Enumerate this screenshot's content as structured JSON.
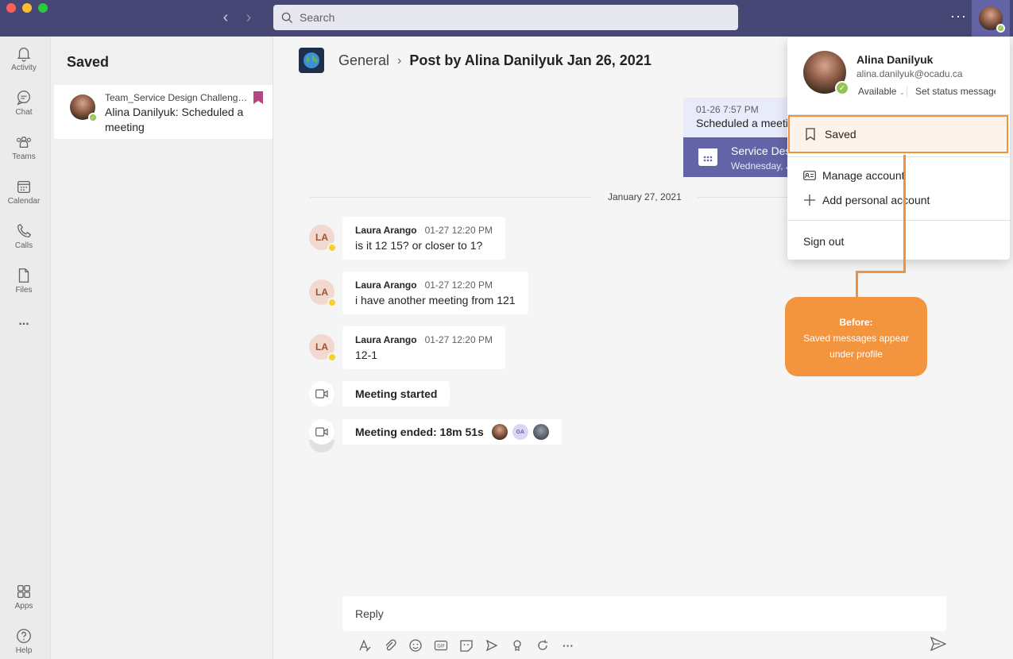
{
  "search": {
    "placeholder": "Search"
  },
  "rail": {
    "items": [
      {
        "label": "Activity",
        "icon": "bell-icon"
      },
      {
        "label": "Chat",
        "icon": "chat-icon"
      },
      {
        "label": "Teams",
        "icon": "teams-icon"
      },
      {
        "label": "Calendar",
        "icon": "calendar-icon"
      },
      {
        "label": "Calls",
        "icon": "phone-icon"
      },
      {
        "label": "Files",
        "icon": "file-icon"
      },
      {
        "label": "Apps",
        "icon": "apps-icon"
      },
      {
        "label": "Help",
        "icon": "help-icon"
      }
    ],
    "more": "..."
  },
  "saved": {
    "title": "Saved",
    "items": [
      {
        "team": "Team_Service Design Challenge 2...",
        "text": "Alina Danilyuk: Scheduled a meeting"
      }
    ]
  },
  "header": {
    "channel": "General",
    "post_title": "Post by Alina Danilyuk Jan 26, 2021"
  },
  "original_post": {
    "time": "01-26 7:57 PM",
    "text": "Scheduled a meeting",
    "meeting_title": "Service Design",
    "meeting_sub": "Wednesday, January 27"
  },
  "date_divider": "January 27, 2021",
  "messages": [
    {
      "initials": "LA",
      "author": "Laura Arango",
      "time": "01-27 12:20 PM",
      "body": "is it 12 15? or closer to 1?"
    },
    {
      "initials": "LA",
      "author": "Laura Arango",
      "time": "01-27 12:20 PM",
      "body": "i have another meeting from 121"
    },
    {
      "initials": "LA",
      "author": "Laura Arango",
      "time": "01-27 12:20 PM",
      "body": "12-1"
    }
  ],
  "events": {
    "started": "Meeting started",
    "ended": "Meeting ended: 18m 51s",
    "participant_initials": "GA"
  },
  "reply": {
    "placeholder": "Reply"
  },
  "profile_menu": {
    "name": "Alina Danilyuk",
    "email": "alina.danilyuk@ocadu.ca",
    "status": "Available",
    "set_status": "Set status message",
    "saved": "Saved",
    "manage_account": "Manage account",
    "add_account": "Add personal account",
    "sign_out": "Sign out"
  },
  "annotation": {
    "title": "Before:",
    "text": "Saved messages appear under profile"
  },
  "colors": {
    "titlebar": "#464775",
    "accent": "#6264a7",
    "highlight": "#f0923c",
    "callout": "#f3953f",
    "available": "#92c353",
    "away": "#f8d22a"
  }
}
